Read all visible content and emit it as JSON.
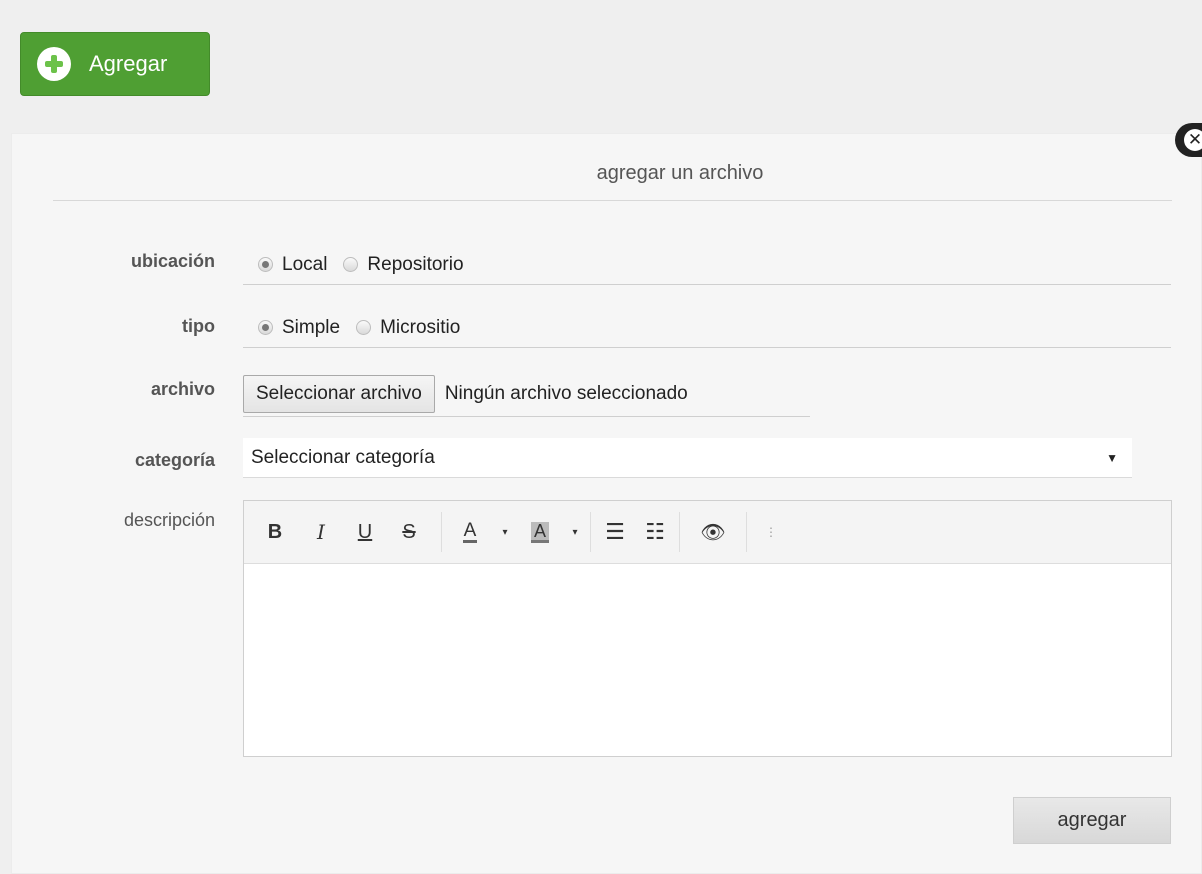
{
  "add_button": {
    "label": "Agregar",
    "color": "#4f9f33"
  },
  "modal": {
    "title": "agregar un archivo"
  },
  "form": {
    "ubicacion": {
      "label": "ubicación",
      "options": [
        "Local",
        "Repositorio"
      ],
      "selected": "Local"
    },
    "tipo": {
      "label": "tipo",
      "options": [
        "Simple",
        "Micrositio"
      ],
      "selected": "Simple"
    },
    "archivo": {
      "label": "archivo",
      "button": "Seleccionar archivo",
      "status": "Ningún archivo seleccionado"
    },
    "categoria": {
      "label": "categoría",
      "value": "Seleccionar categoría"
    },
    "descripcion": {
      "label": "descripción",
      "value": ""
    }
  },
  "toolbar": {
    "bold": "B",
    "italic": "I",
    "underline": "U",
    "strike": "S",
    "font_color": "A",
    "highlight": "A",
    "caret": "▾",
    "bullet_list": "☰",
    "ordered_list": "☷",
    "preview": "👁",
    "more": "⋮"
  },
  "submit_label": "agregar"
}
